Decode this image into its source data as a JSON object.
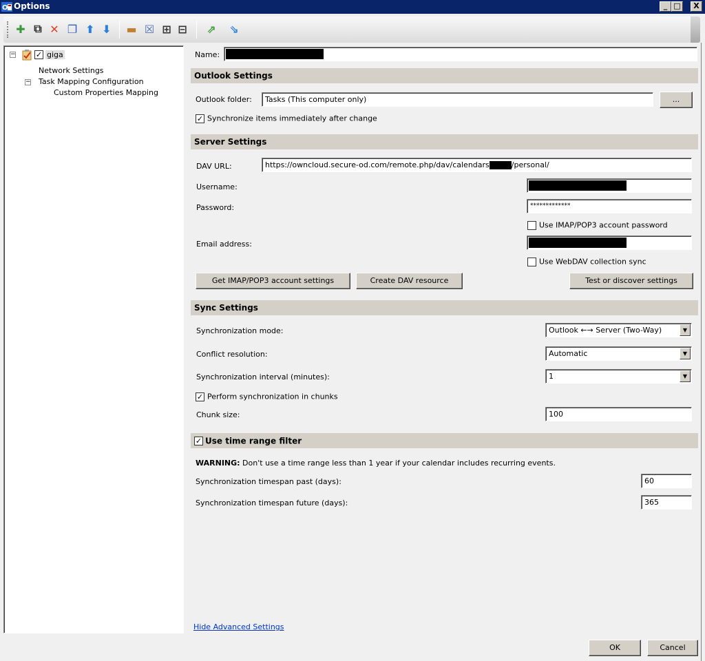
{
  "window": {
    "title": "Options",
    "minimize_label": "_",
    "maximize_label": "□",
    "close_label": "X"
  },
  "toolbar": {
    "buttons": [
      {
        "name": "add-icon",
        "glyph": "✚",
        "color": "#3a9a3a"
      },
      {
        "name": "add-multiple-icon",
        "glyph": "⧉",
        "color": "#333333"
      },
      {
        "name": "delete-icon",
        "glyph": "✕",
        "color": "#e04020"
      },
      {
        "name": "copy-icon",
        "glyph": "❐",
        "color": "#3060c0"
      },
      {
        "name": "move-up-icon",
        "glyph": "⬆",
        "color": "#2a80e0"
      },
      {
        "name": "move-down-icon",
        "glyph": "⬇",
        "color": "#2a80e0"
      },
      {
        "name": "folder-icon",
        "glyph": "▬",
        "color": "#c08030"
      },
      {
        "name": "clear-cache-icon",
        "glyph": "☒",
        "color": "#5070b0"
      },
      {
        "name": "expand-all-icon",
        "glyph": "⊞",
        "color": "#333333"
      },
      {
        "name": "collapse-all-icon",
        "glyph": "⊟",
        "color": "#333333"
      },
      {
        "name": "export-icon",
        "glyph": "⇗",
        "color": "#3a9a3a"
      },
      {
        "name": "import-icon",
        "glyph": "⇘",
        "color": "#2a80e0"
      }
    ]
  },
  "tree": {
    "root": {
      "label": "giga",
      "checked": true,
      "check_glyph": "✓",
      "expander": "−"
    },
    "children": [
      {
        "label": "Network Settings"
      },
      {
        "label": "Task Mapping Configuration",
        "expander": "−"
      },
      {
        "label": "Custom Properties Mapping"
      }
    ]
  },
  "form": {
    "name_label": "Name:",
    "outlook_settings": {
      "header": "Outlook Settings",
      "folder_label": "Outlook folder:",
      "folder_value": "Tasks (This computer only)",
      "browse_label": "...",
      "sync_immediately_label": "Synchronize items immediately after change",
      "sync_immediately_checked": true
    },
    "server_settings": {
      "header": "Server Settings",
      "dav_url_label": "DAV URL:",
      "dav_url_prefix": "https://owncloud.secure-od.com/remote.php/dav/calendars",
      "dav_url_suffix": "/personal/",
      "username_label": "Username:",
      "password_label": "Password:",
      "password_value": "*************",
      "use_imap_password_label": "Use IMAP/POP3 account password",
      "use_imap_password_checked": false,
      "email_label": "Email address:",
      "use_webdav_sync_label": "Use WebDAV collection sync",
      "use_webdav_sync_checked": false,
      "get_imap_button": "Get IMAP/POP3 account settings",
      "create_dav_button": "Create DAV resource",
      "test_button": "Test or discover settings"
    },
    "sync_settings": {
      "header": "Sync Settings",
      "mode_label": "Synchronization mode:",
      "mode_value": "Outlook ←→ Server (Two-Way)",
      "conflict_label": "Conflict resolution:",
      "conflict_value": "Automatic",
      "interval_label": "Synchronization interval (minutes):",
      "interval_value": "1",
      "chunks_label": "Perform synchronization in chunks",
      "chunks_checked": true,
      "chunk_size_label": "Chunk size:",
      "chunk_size_value": "100",
      "dropdown_arrow": "▼"
    },
    "time_range": {
      "header": "Use time range filter",
      "checked": true,
      "warning_bold": "WARNING:",
      "warning_text": " Don't use a time range less than 1 year if your calendar includes recurring events.",
      "past_label": "Synchronization timespan past (days):",
      "past_value": "60",
      "future_label": "Synchronization timespan future (days):",
      "future_value": "365"
    },
    "check_glyph": "✓"
  },
  "footer": {
    "hide_advanced_link": "Hide Advanced Settings",
    "ok_label": "OK",
    "cancel_label": "Cancel"
  }
}
